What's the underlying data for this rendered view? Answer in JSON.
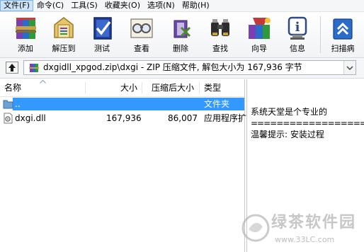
{
  "menu": {
    "items": [
      {
        "label": "文件(F)",
        "active": true
      },
      {
        "label": "命令(C)"
      },
      {
        "label": "工具(S)"
      },
      {
        "label": "收藏夹(O)"
      },
      {
        "label": "选项(N)"
      },
      {
        "label": "帮助(H)"
      }
    ]
  },
  "toolbar": {
    "buttons": [
      {
        "label": "添加",
        "icon": "add-archive-icon"
      },
      {
        "label": "解压到",
        "icon": "extract-to-icon"
      },
      {
        "label": "测试",
        "icon": "test-icon"
      },
      {
        "label": "查看",
        "icon": "view-icon"
      },
      {
        "label": "删除",
        "icon": "delete-icon"
      },
      {
        "label": "查找",
        "icon": "find-icon"
      },
      {
        "label": "向导",
        "icon": "wizard-icon"
      },
      {
        "label": "信息",
        "icon": "info-icon"
      },
      {
        "label": "扫描病",
        "icon": "virus-scan-icon"
      }
    ]
  },
  "address": {
    "path": "dxgidll_xpgod.zip\\dxgi - ZIP 压缩文件, 解包大小为 167,936 字节"
  },
  "filelist": {
    "columns": {
      "name": "名称",
      "size": "大小",
      "packed": "压缩后大小",
      "type": "类型"
    },
    "rows": [
      {
        "name": "..",
        "size": "",
        "packed": "",
        "type": "文件夹",
        "selected": true
      },
      {
        "name": "dxgi.dll",
        "size": "167,936",
        "packed": "86,007",
        "type": "应用程序扩"
      }
    ]
  },
  "comment": {
    "lines": [
      "系统天堂是个专业的",
      "==================",
      "温馨提示: 安装过程"
    ]
  },
  "watermark": {
    "text": "绿茶软件园",
    "url": "www.33LC.com"
  },
  "colors": {
    "selection": "#3399ff",
    "menu_active": "#cfe3f8"
  }
}
